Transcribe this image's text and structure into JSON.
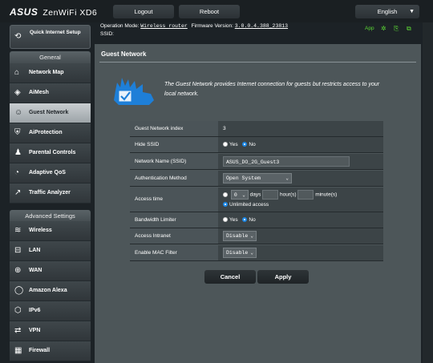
{
  "header": {
    "brand": "ASUS",
    "model": "ZenWiFi XD6",
    "logout_label": "Logout",
    "reboot_label": "Reboot",
    "language": "English"
  },
  "status": {
    "operation_mode_label": "Operation Mode:",
    "operation_mode_value": "Wireless router",
    "firmware_label": "Firmware Version:",
    "firmware_value": "3.0.0.4.388_23813",
    "ssid_label": "SSID:",
    "app_label": "App"
  },
  "sidebar": {
    "quick_setup": "Quick Internet Setup",
    "general_title": "General",
    "general_items": [
      {
        "label": "Network Map",
        "icon": "network-map-icon"
      },
      {
        "label": "AiMesh",
        "icon": "aimesh-icon"
      },
      {
        "label": "Guest Network",
        "icon": "guest-network-icon",
        "active": true
      },
      {
        "label": "AiProtection",
        "icon": "aiprotection-icon"
      },
      {
        "label": "Parental Controls",
        "icon": "parental-controls-icon"
      },
      {
        "label": "Adaptive QoS",
        "icon": "adaptive-qos-icon"
      },
      {
        "label": "Traffic Analyzer",
        "icon": "traffic-analyzer-icon"
      }
    ],
    "advanced_title": "Advanced Settings",
    "advanced_items": [
      {
        "label": "Wireless",
        "icon": "wireless-icon"
      },
      {
        "label": "LAN",
        "icon": "lan-icon"
      },
      {
        "label": "WAN",
        "icon": "wan-icon"
      },
      {
        "label": "Amazon Alexa",
        "icon": "alexa-icon"
      },
      {
        "label": "IPv6",
        "icon": "ipv6-icon"
      },
      {
        "label": "VPN",
        "icon": "vpn-icon"
      },
      {
        "label": "Firewall",
        "icon": "firewall-icon"
      }
    ]
  },
  "main": {
    "title": "Guest Network",
    "description": "The Guest Network provides Internet connection for guests but restricts access to your local network.",
    "form": {
      "index_label": "Guest Network index",
      "index_value": "3",
      "hide_ssid_label": "Hide SSID",
      "yes": "Yes",
      "no": "No",
      "ssid_label": "Network Name (SSID)",
      "ssid_value": "ASUS_DO_2G_Guest3",
      "auth_label": "Authentication Method",
      "auth_value": "Open System",
      "access_time_label": "Access time",
      "days_value": "0",
      "days_label": "days",
      "hours_label": "hour(s)",
      "minutes_label": "minute(s)",
      "unlimited_label": "Unlimited access",
      "bandwidth_label": "Bandwidth Limiter",
      "intranet_label": "Access Intranet",
      "intranet_value": "Disable",
      "mac_filter_label": "Enable MAC Filter",
      "mac_filter_value": "Disable"
    },
    "cancel_label": "Cancel",
    "apply_label": "Apply"
  },
  "colors": {
    "accent_green": "#5bd834",
    "radio_blue": "#1e88e5",
    "panel_bg": "#4d5659"
  }
}
